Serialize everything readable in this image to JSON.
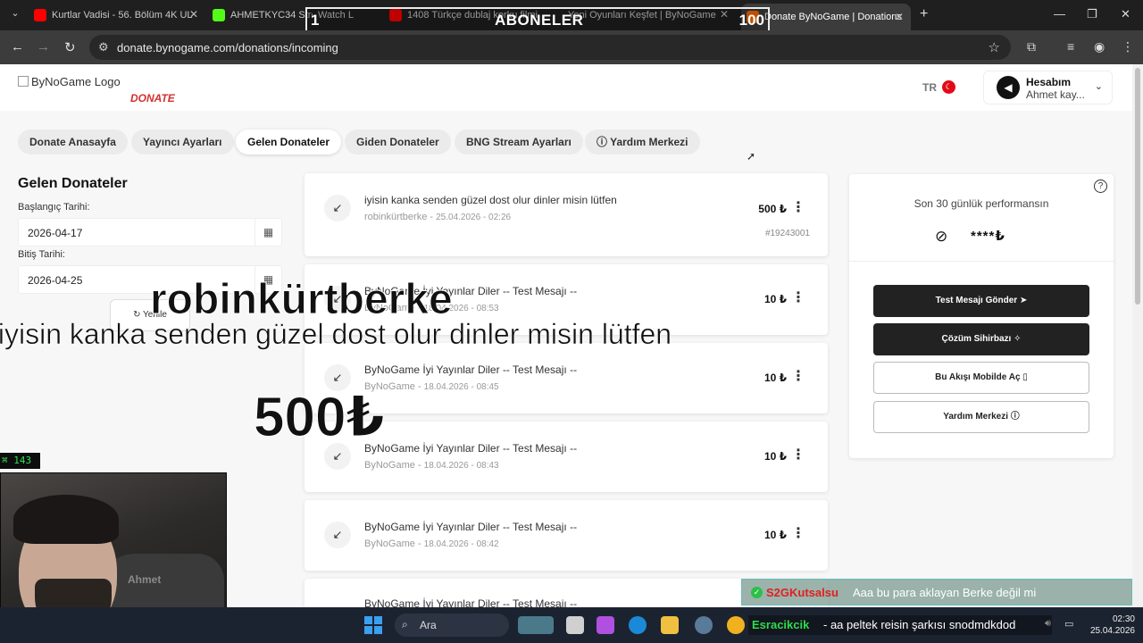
{
  "browser": {
    "tabs": [
      {
        "title": "Kurtlar Vadisi - 56. Bölüm 4K UL",
        "fav": "#ff0000"
      },
      {
        "title": "AHMETKYC34 Strea",
        "fav": "#53fc18"
      },
      {
        "title": "Watch L",
        "fav": "#9146ff"
      },
      {
        "title": "1408 Türkçe dublaj korku filmi",
        "fav": "#ff0000"
      },
      {
        "title": "Yeni Oyunları Keşfet | ByNoGame",
        "fav": "#444444"
      },
      {
        "title": "Donate ByNoGame | Donations",
        "fav": "#ff6a00"
      }
    ],
    "url": "donate.bynogame.com/donations/incoming"
  },
  "stream_overlay": {
    "subs_label": "ABONELER",
    "subs_current": "1",
    "subs_goal": "100",
    "alert_name": "robinkürtberke",
    "alert_message": "iyisin kanka senden güzel dost olur dinler misin lütfen",
    "alert_amount": "500₺",
    "viewer_counter": "⌘ 143",
    "cam_shirt_text": "Ahmet"
  },
  "header": {
    "logo_alt": "ByNoGame Logo",
    "logo_sub": "DONATE",
    "lang": "TR",
    "account_title": "Hesabım",
    "account_name": "Ahmet kay..."
  },
  "nav": {
    "tabs": [
      "Donate Anasayfa",
      "Yayıncı Ayarları",
      "Gelen Donateler",
      "Giden Donateler",
      "BNG Stream Ayarları",
      "Yardım Merkezi"
    ],
    "active": "Gelen Donateler"
  },
  "filters": {
    "title": "Gelen Donateler",
    "start_label": "Başlangıç Tarihi:",
    "start_value": "2026-04-17",
    "end_label": "Bitiş Tarihi:",
    "end_value": "2026-04-25",
    "refresh_label": "Yenile"
  },
  "donations": [
    {
      "message": "iyisin kanka senden güzel dost olur dinler misin lütfen",
      "sender": "robinkürtberke",
      "date": "25.04.2026 - 02:26",
      "amount": "500 ₺",
      "id": "#19243001"
    },
    {
      "message": "ByNoGame İyi Yayınlar Diler -- Test Mesajı --",
      "sender": "ByNoGame",
      "date": "18.04.2026 - 08:53",
      "amount": "10 ₺",
      "id": ""
    },
    {
      "message": "ByNoGame İyi Yayınlar Diler -- Test Mesajı --",
      "sender": "ByNoGame",
      "date": "18.04.2026 - 08:45",
      "amount": "10 ₺",
      "id": ""
    },
    {
      "message": "ByNoGame İyi Yayınlar Diler -- Test Mesajı --",
      "sender": "ByNoGame",
      "date": "18.04.2026 - 08:43",
      "amount": "10 ₺",
      "id": ""
    },
    {
      "message": "ByNoGame İyi Yayınlar Diler -- Test Mesajı --",
      "sender": "ByNoGame",
      "date": "18.04.2026 - 08:42",
      "amount": "10 ₺",
      "id": ""
    },
    {
      "message": "ByNoGame İyi Yayınlar Diler -- Test Mesajı --",
      "sender": "",
      "date": "",
      "amount": "",
      "id": ""
    }
  ],
  "performance": {
    "title": "Son 30 günlük performansın",
    "value": "****₺",
    "buttons": [
      "Test Mesajı Gönder",
      "Çözüm Sihirbazı",
      "Bu Akışı Mobilde Aç",
      "Yardım Merkezi"
    ]
  },
  "chat": [
    {
      "user": "S2GKutsalsu",
      "text": "Aaa bu para aklayan Berke değil mi"
    },
    {
      "user": "Esracikcik",
      "text": "- aa peltek reisin şarkısı snodmdkdod"
    }
  ],
  "taskbar": {
    "search": "Ara",
    "time": "02:30",
    "date": "25.04.2026"
  }
}
